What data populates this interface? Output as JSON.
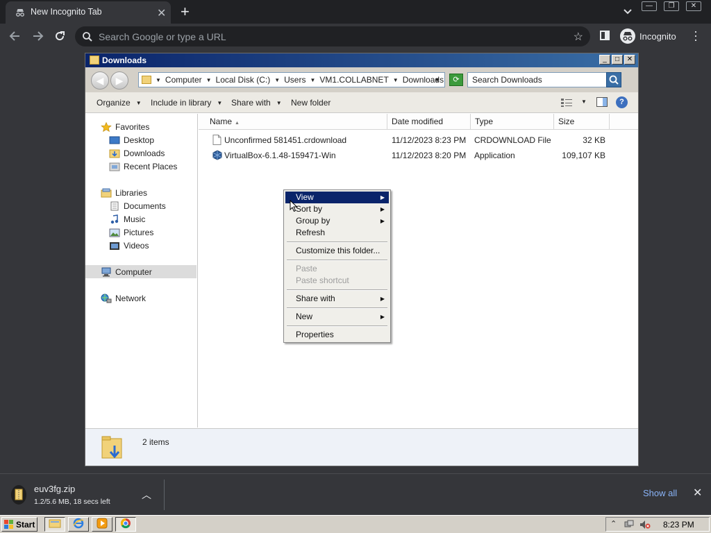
{
  "browser": {
    "tab_title": "New Incognito Tab",
    "omnibox_placeholder": "Search Google or type a URL",
    "profile_label": "Incognito"
  },
  "explorer": {
    "title": "Downloads",
    "breadcrumbs": [
      "Computer",
      "Local Disk (C:)",
      "Users",
      "VM1.COLLABNET",
      "Downloads"
    ],
    "search_placeholder": "Search Downloads",
    "commands": {
      "organize": "Organize",
      "include_in_library": "Include in library",
      "share_with": "Share with",
      "new_folder": "New folder"
    },
    "nav": {
      "favorites": "Favorites",
      "desktop": "Desktop",
      "downloads": "Downloads",
      "recent_places": "Recent Places",
      "libraries": "Libraries",
      "documents": "Documents",
      "music": "Music",
      "pictures": "Pictures",
      "videos": "Videos",
      "computer": "Computer",
      "network": "Network"
    },
    "columns": {
      "name": "Name",
      "date_modified": "Date modified",
      "type": "Type",
      "size": "Size"
    },
    "files": [
      {
        "name": "Unconfirmed 581451.crdownload",
        "date": "11/12/2023 8:23 PM",
        "type": "CRDOWNLOAD File",
        "size": "32 KB"
      },
      {
        "name": "VirtualBox-6.1.48-159471-Win",
        "date": "11/12/2023 8:20 PM",
        "type": "Application",
        "size": "109,107 KB"
      }
    ],
    "item_count": "2 items"
  },
  "context_menu": {
    "view": "View",
    "sort_by": "Sort by",
    "group_by": "Group by",
    "refresh": "Refresh",
    "customize": "Customize this folder...",
    "paste": "Paste",
    "paste_shortcut": "Paste shortcut",
    "share_with": "Share with",
    "new": "New",
    "properties": "Properties"
  },
  "download_shelf": {
    "file_name": "euv3fg.zip",
    "status": "1.2/5.6 MB, 18 secs left",
    "show_all": "Show all"
  },
  "taskbar": {
    "start_label": "Start",
    "clock": "8:23 PM"
  },
  "colors": {
    "menu_highlight": "#0a246a",
    "chrome_bg": "#35363a",
    "link_blue": "#8ab4f8"
  }
}
